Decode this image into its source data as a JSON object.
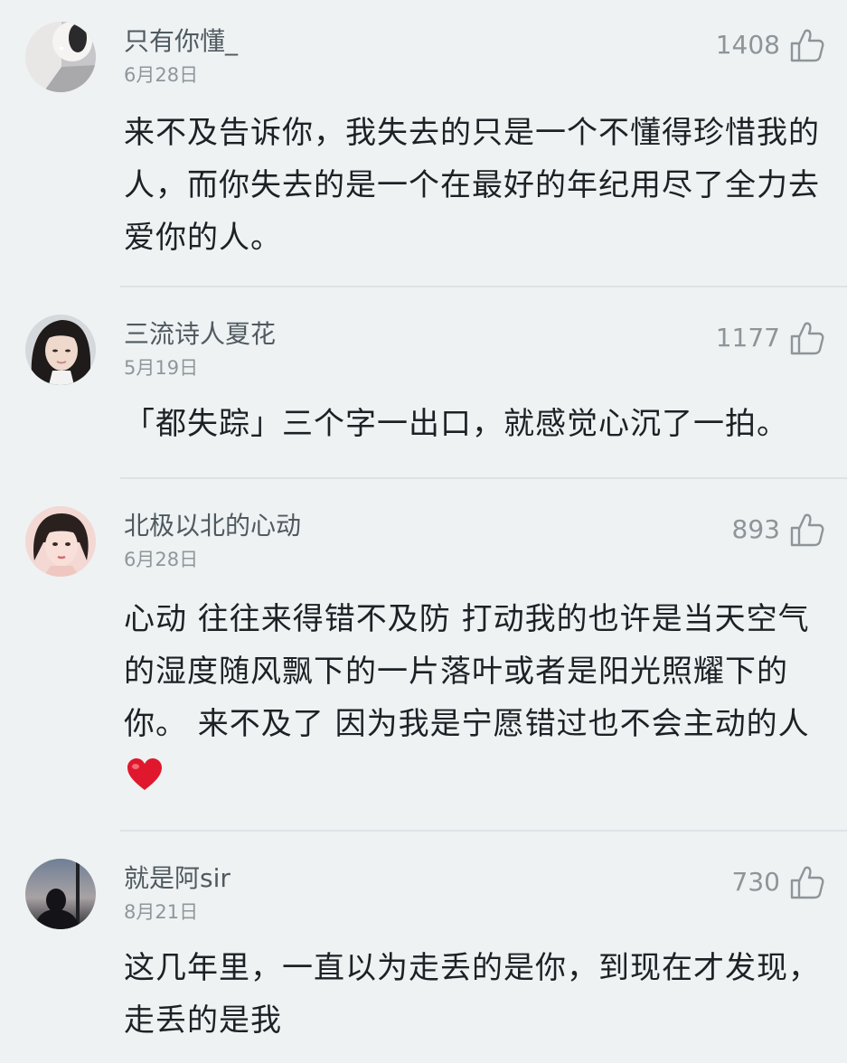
{
  "comments": [
    {
      "username": "只有你懂_",
      "date": "6月28日",
      "likes": "1408",
      "text": "来不及告诉你，我失去的只是一个不懂得珍惜我的人，而你失去的是一个在最好的年纪用尽了全力去爱你的人。"
    },
    {
      "username": "三流诗人夏花",
      "date": "5月19日",
      "likes": "1177",
      "text": "「都失踪」三个字一出口，就感觉心沉了一拍。"
    },
    {
      "username": "北极以北的心动",
      "date": "6月28日",
      "likes": "893",
      "text": "心动 往往来得错不及防 打动我的也许是当天空气的湿度随风飘下的一片落叶或者是阳光照耀下的你。 来不及了 因为我是宁愿错过也不会主动的人"
    },
    {
      "username": "就是阿sir",
      "date": "8月21日",
      "likes": "730",
      "text": "这几年里，一直以为走丢的是你，到现在才发现，走丢的是我"
    }
  ],
  "colors": {
    "background": "#eef2f3",
    "username": "#505a60",
    "date": "#8e979b",
    "body_text": "#1c2125",
    "like_count": "#8d9599",
    "heart": "#e0182d"
  }
}
